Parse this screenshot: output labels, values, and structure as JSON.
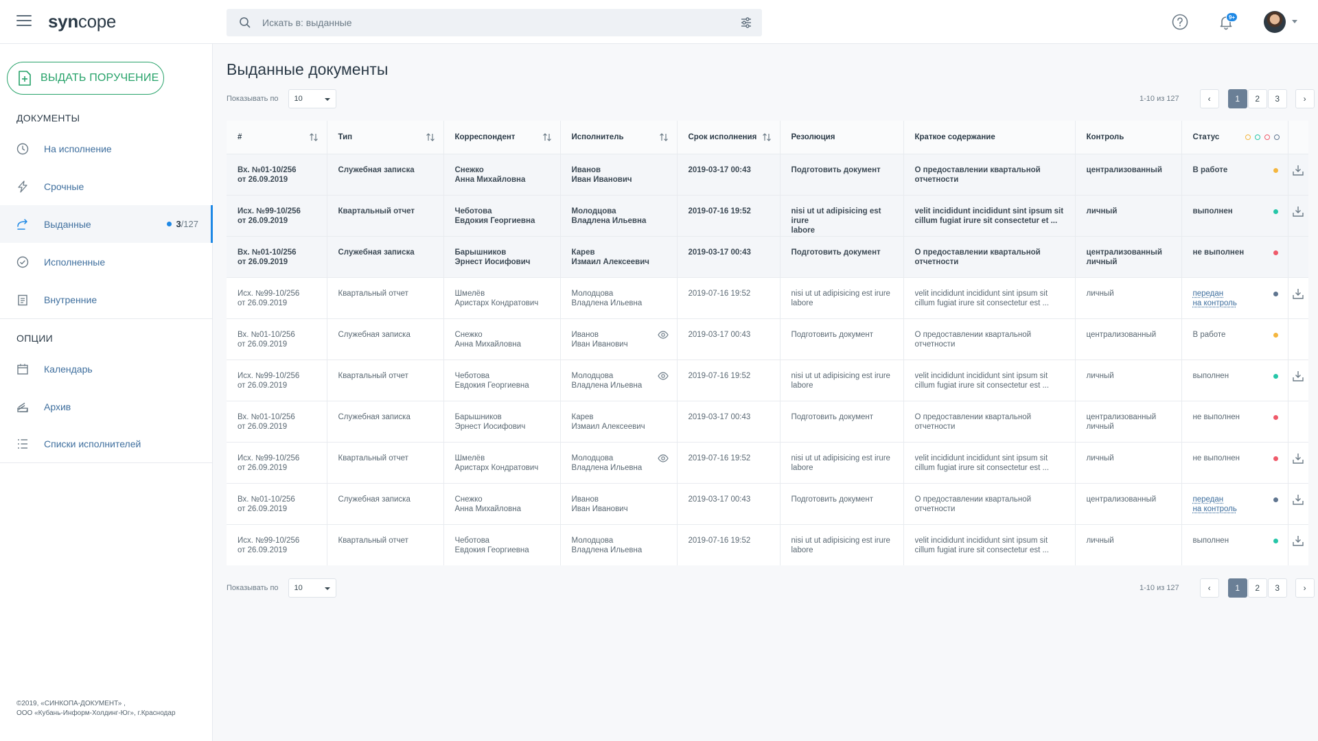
{
  "header": {
    "logo_bold": "syn",
    "logo_rest": "cope",
    "search_placeholder": "Искать в: выданные",
    "notifications_badge": "9+"
  },
  "sidebar": {
    "issue_button": "ВЫДАТЬ ПОРУЧЕНИЕ",
    "documents_title": "ДОКУМЕНТЫ",
    "documents": [
      {
        "label": "На исполнение",
        "icon": "clock-icon"
      },
      {
        "label": "Срочные",
        "icon": "lightning-icon"
      },
      {
        "label": "Выданные",
        "icon": "send-icon",
        "count_bold": "3",
        "count_total": "/127",
        "active": true
      },
      {
        "label": "Исполненные",
        "icon": "check-circle-icon"
      },
      {
        "label": "Внутренние",
        "icon": "clipboard-icon"
      }
    ],
    "options_title": "ОПЦИИ",
    "options": [
      {
        "label": "Календарь",
        "icon": "calendar-icon"
      },
      {
        "label": "Архив",
        "icon": "archive-icon"
      },
      {
        "label": "Списки исполнителей",
        "icon": "list-icon"
      }
    ],
    "footer_line1": "©2019,  «СИНКОПА-ДОКУМЕНТ» ,",
    "footer_line2": "ООО «Кубань-Информ-Холдинг-Юг», г.Краснодар"
  },
  "main": {
    "title": "Выданные документы",
    "per_page_label": "Показывать по",
    "per_page_value": "10",
    "range": "1-10 из 127",
    "pages": [
      "1",
      "2",
      "3"
    ],
    "current_page": "1"
  },
  "table": {
    "columns": [
      "#",
      "Тип",
      "Корреспондент",
      "Исполнитель",
      "Срок исполнения",
      "Резолюция",
      "Краткое содержание",
      "Контроль",
      "Статус"
    ],
    "status_colors": {
      "yellow": "#f4b63f",
      "teal": "#26c6a8",
      "red": "#ef5a6a",
      "slate": "#5f7590"
    },
    "rows": [
      {
        "bold": true,
        "num1": "Вх. №01-10/256",
        "num2": "от 26.09.2019",
        "type": "Служебная записка",
        "corr1": "Снежко",
        "corr2": "Анна Михайловна",
        "exec1": "Иванов",
        "exec2": "Иван Иванович",
        "eye": false,
        "due": "2019-03-17 00:43",
        "res1": "Подготовить документ",
        "res2": "",
        "sum1": "О предоставлении квартальной",
        "sum2": "отчетности",
        "ctrl1": "централизованный",
        "ctrl2": "",
        "status1": "В работе",
        "status2": "",
        "status_link": false,
        "dot": "#f4b63f",
        "download": true
      },
      {
        "bold": true,
        "num1": "Исх. №99-10/256",
        "num2": "от 26.09.2019",
        "type": "Квартальный отчет",
        "corr1": "Чеботова",
        "corr2": "Евдокия Георгиевна",
        "exec1": "Молодцова",
        "exec2": "Владлена Ильевна",
        "eye": false,
        "due": "2019-07-16 19:52",
        "res1": "nisi ut ut adipisicing est irure",
        "res2": "labore",
        "sum1": "velit incididunt incididunt sint ipsum sit",
        "sum2": "cillum fugiat irure sit consectetur et ...",
        "ctrl1": "личный",
        "ctrl2": "",
        "status1": "выполнен",
        "status2": "",
        "status_link": false,
        "dot": "#26c6a8",
        "download": true
      },
      {
        "bold": true,
        "num1": "Вх. №01-10/256",
        "num2": "от 26.09.2019",
        "type": "Служебная записка",
        "corr1": "Барышников",
        "corr2": "Эрнест Иосифович",
        "exec1": "Карев",
        "exec2": "Измаил Алексеевич",
        "eye": false,
        "due": "2019-03-17 00:43",
        "res1": "Подготовить документ",
        "res2": "",
        "sum1": "О предоставлении квартальной",
        "sum2": "отчетности",
        "ctrl1": "централизованный",
        "ctrl2": "личный",
        "status1": "не выполнен",
        "status2": "",
        "status_link": false,
        "dot": "#ef5a6a",
        "download": false
      },
      {
        "bold": false,
        "num1": "Исх. №99-10/256",
        "num2": "от 26.09.2019",
        "type": "Квартальный отчет",
        "corr1": "Шмелёв",
        "corr2": "Аристарх Кондратович",
        "exec1": "Молодцова",
        "exec2": "Владлена Ильевна",
        "eye": false,
        "due": "2019-07-16 19:52",
        "res1": "nisi ut ut adipisicing est irure",
        "res2": "labore",
        "sum1": "velit incididunt incididunt sint ipsum sit",
        "sum2": "cillum fugiat irure sit consectetur est ...",
        "ctrl1": "личный",
        "ctrl2": "",
        "status1": "передан",
        "status2": "на контроль",
        "status_link": true,
        "dot": "#5f7590",
        "download": true
      },
      {
        "bold": false,
        "num1": "Вх. №01-10/256",
        "num2": "от 26.09.2019",
        "type": "Служебная записка",
        "corr1": "Снежко",
        "corr2": "Анна Михайловна",
        "exec1": "Иванов",
        "exec2": "Иван Иванович",
        "eye": true,
        "due": "2019-03-17 00:43",
        "res1": "Подготовить документ",
        "res2": "",
        "sum1": "О предоставлении квартальной",
        "sum2": "отчетности",
        "ctrl1": "централизованный",
        "ctrl2": "",
        "status1": "В работе",
        "status2": "",
        "status_link": false,
        "dot": "#f4b63f",
        "download": false
      },
      {
        "bold": false,
        "num1": "Исх. №99-10/256",
        "num2": "от 26.09.2019",
        "type": "Квартальный отчет",
        "corr1": "Чеботова",
        "corr2": "Евдокия Георгиевна",
        "exec1": "Молодцова",
        "exec2": "Владлена Ильевна",
        "eye": true,
        "due": "2019-07-16 19:52",
        "res1": "nisi ut ut adipisicing est irure",
        "res2": "labore",
        "sum1": "velit incididunt incididunt sint ipsum sit",
        "sum2": "cillum fugiat irure sit consectetur est ...",
        "ctrl1": "личный",
        "ctrl2": "",
        "status1": "выполнен",
        "status2": "",
        "status_link": false,
        "dot": "#26c6a8",
        "download": true
      },
      {
        "bold": false,
        "num1": "Вх. №01-10/256",
        "num2": "от 26.09.2019",
        "type": "Служебная записка",
        "corr1": "Барышников",
        "corr2": "Эрнест Иосифович",
        "exec1": "Карев",
        "exec2": "Измаил Алексеевич",
        "eye": false,
        "due": "2019-03-17 00:43",
        "res1": "Подготовить документ",
        "res2": "",
        "sum1": "О предоставлении квартальной",
        "sum2": "отчетности",
        "ctrl1": "централизованный",
        "ctrl2": "личный",
        "status1": "не выполнен",
        "status2": "",
        "status_link": false,
        "dot": "#ef5a6a",
        "download": false
      },
      {
        "bold": false,
        "num1": "Исх. №99-10/256",
        "num2": "от 26.09.2019",
        "type": "Квартальный отчет",
        "corr1": "Шмелёв",
        "corr2": "Аристарх Кондратович",
        "exec1": "Молодцова",
        "exec2": "Владлена Ильевна",
        "eye": true,
        "due": "2019-07-16 19:52",
        "res1": "nisi ut ut adipisicing est irure",
        "res2": "labore",
        "sum1": "velit incididunt incididunt sint ipsum sit",
        "sum2": "cillum fugiat irure sit consectetur est ...",
        "ctrl1": "личный",
        "ctrl2": "",
        "status1": "не выполнен",
        "status2": "",
        "status_link": false,
        "dot": "#ef5a6a",
        "download": true
      },
      {
        "bold": false,
        "num1": "Вх. №01-10/256",
        "num2": "от 26.09.2019",
        "type": "Служебная записка",
        "corr1": "Снежко",
        "corr2": "Анна Михайловна",
        "exec1": "Иванов",
        "exec2": "Иван Иванович",
        "eye": false,
        "due": "2019-03-17 00:43",
        "res1": "Подготовить документ",
        "res2": "",
        "sum1": "О предоставлении квартальной",
        "sum2": "отчетности",
        "ctrl1": "централизованный",
        "ctrl2": "",
        "status1": "передан",
        "status2": "на контроль",
        "status_link": true,
        "dot": "#5f7590",
        "download": true
      },
      {
        "bold": false,
        "num1": "Исх. №99-10/256",
        "num2": "от 26.09.2019",
        "type": "Квартальный отчет",
        "corr1": "Чеботова",
        "corr2": "Евдокия Георгиевна",
        "exec1": "Молодцова",
        "exec2": "Владлена Ильевна",
        "eye": false,
        "due": "2019-07-16 19:52",
        "res1": "nisi ut ut adipisicing est irure",
        "res2": "labore",
        "sum1": "velit incididunt incididunt sint ipsum sit",
        "sum2": "cillum fugiat irure sit consectetur est ...",
        "ctrl1": "личный",
        "ctrl2": "",
        "status1": "выполнен",
        "status2": "",
        "status_link": false,
        "dot": "#26c6a8",
        "download": true
      }
    ]
  }
}
